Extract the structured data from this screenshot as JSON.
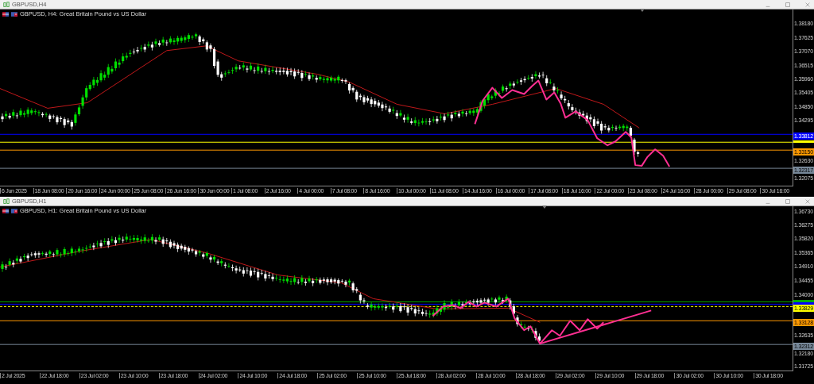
{
  "windows": [
    {
      "title": "GBPUSD,H4",
      "chart_label": "GBPUSD, H4:  Great Britain Pound vs US Dollar",
      "price_ticks": [
        "1.38180",
        "1.37625",
        "1.37070",
        "1.36515",
        "1.35960",
        "1.35405",
        "1.34850",
        "1.34295",
        "1.32630",
        "1.32075"
      ],
      "price_tags": [
        {
          "text": "1.33812",
          "color": "#0000ff"
        },
        {
          "color": "#ffff00"
        },
        {
          "text": "1.33150",
          "color": "#ff9900"
        },
        {
          "text": "1.32317",
          "color": "#778899"
        }
      ],
      "time_ticks": [
        "6 Jun 2025",
        "18 Jun 08:00",
        "20 Jun 16:00",
        "24 Jun 00:00",
        "25 Jun 08:00",
        "26 Jun 16:00",
        "30 Jun 00:00",
        "1 Jul 08:00",
        "2 Jul 16:00",
        "4 Jul 00:00",
        "7 Jul 08:00",
        "8 Jul 16:00",
        "10 Jul 00:00",
        "11 Jul 08:00",
        "14 Jul 16:00",
        "16 Jul 00:00",
        "17 Jul 08:00",
        "18 Jul 16:00",
        "22 Jul 00:00",
        "23 Jul 08:00",
        "24 Jul 16:00",
        "28 Jul 00:00",
        "29 Jul 08:00",
        "30 Jul 16:00"
      ]
    },
    {
      "title": "GBPUSD,H1",
      "chart_label": "GBPUSD, H1:  Great Britain Pound vs US Dollar",
      "price_ticks": [
        "1.36730",
        "1.36275",
        "1.35820",
        "1.35365",
        "1.34910",
        "1.34455",
        "1.34000",
        "1.32635",
        "1.32180",
        "1.31725"
      ],
      "price_tags": [
        {
          "color": "#00aa00"
        },
        {
          "color": "#0000ff"
        },
        {
          "text": "1.33829",
          "color": "#ffff00"
        },
        {
          "text": "1.33128",
          "color": "#ff9900"
        },
        {
          "text": "1.32312",
          "color": "#778899"
        }
      ],
      "time_ticks": [
        "2 Jul 2025",
        "22 Jul 18:00",
        "23 Jul 02:00",
        "23 Jul 10:00",
        "23 Jul 18:00",
        "24 Jul 02:00",
        "24 Jul 10:00",
        "24 Jul 18:00",
        "25 Jul 02:00",
        "25 Jul 10:00",
        "25 Jul 18:00",
        "28 Jul 02:00",
        "28 Jul 10:00",
        "28 Jul 18:00",
        "29 Jul 02:00",
        "29 Jul 10:00",
        "29 Jul 18:00",
        "30 Jul 02:00",
        "30 Jul 10:00",
        "30 Jul 18:00"
      ]
    }
  ]
}
